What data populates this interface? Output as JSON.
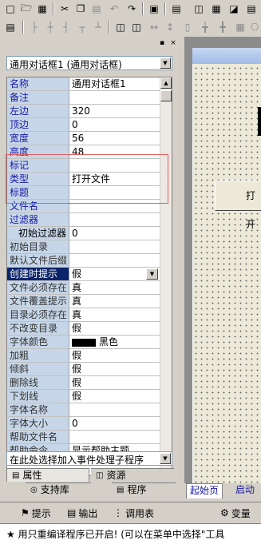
{
  "toolbar1": {
    "icons": [
      "new-file-icon",
      "open-folder-icon",
      "save-icon",
      "cut-icon",
      "copy-icon",
      "paste-icon",
      "undo-icon",
      "redo-icon",
      "window-icon",
      "layout-icon",
      "layout-2-icon",
      "layout-3-icon"
    ]
  },
  "toolbar2": {
    "icons": [
      "align-left-icon",
      "align-center-icon",
      "align-right-icon",
      "align-top-icon",
      "align-middle-icon",
      "align-bottom-icon",
      "size-width-icon",
      "size-height-icon",
      "spacing-icon",
      "center-h-icon",
      "center-v-icon",
      "distribute-icon"
    ]
  },
  "object_selector": {
    "value": "通用对话框1 (通用对话框)"
  },
  "properties": [
    {
      "name": "名称",
      "value": "通用对话框1",
      "style": "blue"
    },
    {
      "name": "备注",
      "value": "",
      "style": "blue"
    },
    {
      "name": "左边",
      "value": "320",
      "style": "blue"
    },
    {
      "name": "顶边",
      "value": "0",
      "style": "blue"
    },
    {
      "name": "宽度",
      "value": "56",
      "style": "blue"
    },
    {
      "name": "高度",
      "value": "48",
      "style": "blue"
    },
    {
      "name": "标记",
      "value": "",
      "style": "blue"
    },
    {
      "name": "类型",
      "value": "打开文件",
      "style": "blue"
    },
    {
      "name": "标题",
      "value": "",
      "style": "blue"
    },
    {
      "name": "文件名",
      "value": "",
      "style": "blue"
    },
    {
      "name": "过滤器",
      "value": "",
      "style": "blue"
    },
    {
      "name": "初始过滤器",
      "value": "0",
      "style": "indent"
    },
    {
      "name": "初始目录",
      "value": "",
      "style": "grey"
    },
    {
      "name": "默认文件后缀",
      "value": "",
      "style": "grey"
    },
    {
      "name": "创建时提示",
      "value": "假",
      "style": "sel"
    },
    {
      "name": "文件必须存在",
      "value": "真",
      "style": "grey"
    },
    {
      "name": "文件覆盖提示",
      "value": "真",
      "style": "grey"
    },
    {
      "name": "目录必须存在",
      "value": "真",
      "style": "grey"
    },
    {
      "name": "不改变目录",
      "value": "假",
      "style": "grey"
    },
    {
      "name": "字体颜色",
      "value": "黑色",
      "style": "grey"
    },
    {
      "name": "加粗",
      "value": "假",
      "style": "grey"
    },
    {
      "name": "倾斜",
      "value": "假",
      "style": "grey"
    },
    {
      "name": "删除线",
      "value": "假",
      "style": "grey"
    },
    {
      "name": "下划线",
      "value": "假",
      "style": "grey"
    },
    {
      "name": "字体名称",
      "value": "",
      "style": "grey"
    },
    {
      "name": "字体大小",
      "value": "0",
      "style": "grey"
    },
    {
      "name": "帮助文件名",
      "value": "",
      "style": "grey"
    },
    {
      "name": "帮助命令",
      "value": "显示帮助主题",
      "style": "grey"
    }
  ],
  "event_selector": {
    "value": "在此处选择加入事件处理子程序"
  },
  "panel_tabs": {
    "properties": "属性",
    "resources": "资源",
    "support_lib": "支持库",
    "program": "程序"
  },
  "canvas": {
    "button_label": "打开"
  },
  "doc_tabs": {
    "start_page": "起始页",
    "next": "启动"
  },
  "bottom_tabs": {
    "hint": "提示",
    "output": "输出",
    "call_table": "调用表",
    "vars": "变量"
  },
  "status": {
    "text": "★ 用只重编译程序已开启! (可以在菜单中选择\"工具"
  },
  "colors": {
    "selection": "#0a246a",
    "name_bg": "#c6d6e8",
    "font_color_swatch": "#000000"
  }
}
